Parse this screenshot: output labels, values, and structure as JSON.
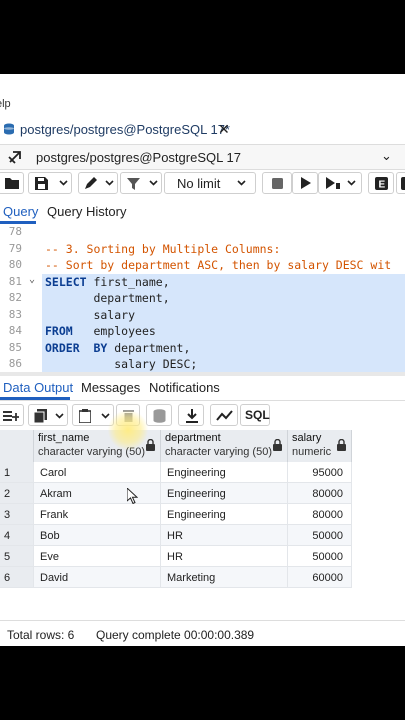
{
  "menu": {
    "partial_label": "elp"
  },
  "query_tab": {
    "title": "postgres/postgres@PostgreSQL 17*"
  },
  "connection": {
    "label": "postgres/postgres@PostgreSQL 17"
  },
  "toolbar": {
    "limit_label": "No limit"
  },
  "query_tabs": [
    "Query",
    "Query History"
  ],
  "editor": {
    "lines": [
      {
        "num": "78",
        "text": ""
      },
      {
        "num": "79",
        "text": "-- 3. Sorting by Multiple Columns:"
      },
      {
        "num": "80",
        "text": "-- Sort by department ASC, then by salary DESC wit"
      },
      {
        "num": "81",
        "kw": "SELECT",
        "rest": " first_name,"
      },
      {
        "num": "82",
        "kw": "",
        "rest": "       department,"
      },
      {
        "num": "83",
        "kw": "",
        "rest": "       salary"
      },
      {
        "num": "84",
        "kw": "FROM",
        "rest": "   employees"
      },
      {
        "num": "85",
        "kw": "ORDER  BY",
        "rest": " department,"
      },
      {
        "num": "86",
        "kw": "",
        "rest": "          salary DESC;"
      }
    ]
  },
  "result_tabs": [
    "Data Output",
    "Messages",
    "Notifications"
  ],
  "grid": {
    "columns": [
      {
        "name": "first_name",
        "type": "character varying (50)"
      },
      {
        "name": "department",
        "type": "character varying (50)"
      },
      {
        "name": "salary",
        "type": "numeric"
      }
    ],
    "rows": [
      {
        "n": "1",
        "first_name": "Carol",
        "department": "Engineering",
        "salary": "95000"
      },
      {
        "n": "2",
        "first_name": "Akram",
        "department": "Engineering",
        "salary": "80000"
      },
      {
        "n": "3",
        "first_name": "Frank",
        "department": "Engineering",
        "salary": "80000"
      },
      {
        "n": "4",
        "first_name": "Bob",
        "department": "HR",
        "salary": "50000"
      },
      {
        "n": "5",
        "first_name": "Eve",
        "department": "HR",
        "salary": "50000"
      },
      {
        "n": "6",
        "first_name": "David",
        "department": "Marketing",
        "salary": "60000"
      }
    ]
  },
  "status": {
    "total_rows": "Total rows: 6",
    "query_complete": "Query complete 00:00:00.389"
  },
  "colors": {
    "accent": "#1f3b63",
    "highlight": "#d6e6fb",
    "comment": "#d35400",
    "keyword": "#0b3d91"
  }
}
